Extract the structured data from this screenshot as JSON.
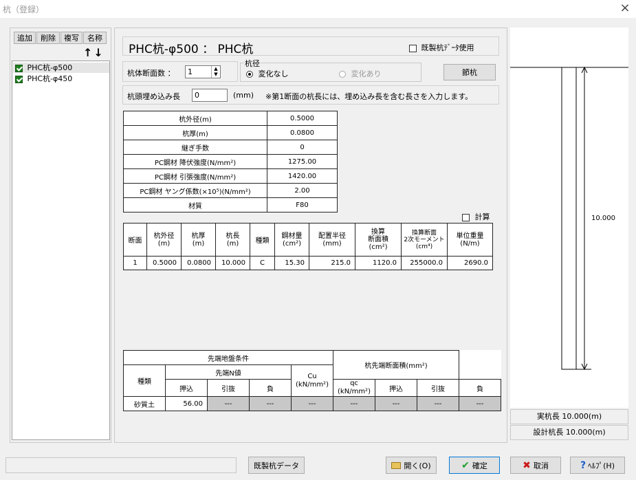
{
  "window": {
    "title": "杭（登録）",
    "close": "×"
  },
  "list": {
    "buttons": [
      "追加",
      "削除",
      "複写",
      "名称"
    ],
    "arrows": "↑↓",
    "items": [
      {
        "label": "PHC杭-φ500",
        "selected": true
      },
      {
        "label": "PHC杭-φ450",
        "selected": false
      }
    ]
  },
  "header": {
    "name": "PHC杭-φ500 ： PHC杭",
    "use_existing": "既製杭ﾃﾞｰﾀ使用"
  },
  "sections": {
    "label": "杭体断面数 ：",
    "value": "1"
  },
  "diameter": {
    "group_label": "杭径",
    "opt1": "変化なし",
    "opt2": "変化あり"
  },
  "node_button": "節杭",
  "embed": {
    "label": "杭頭埋め込み長",
    "value": "0",
    "unit": "(mm)",
    "note": "※第1断面の杭長には、埋め込み長を含む長さを入力します。"
  },
  "props": [
    {
      "name": "杭外径(m)",
      "value": "0.5000"
    },
    {
      "name": "杭厚(m)",
      "value": "0.0800"
    },
    {
      "name": "継ぎ手数",
      "value": "0"
    },
    {
      "name": "PC鋼材 降伏強度(N/mm²)",
      "value": "1275.00"
    },
    {
      "name": "PC鋼材 引張強度(N/mm²)",
      "value": "1420.00"
    },
    {
      "name": "PC鋼材 ヤング係数(×10⁵)(N/mm²)",
      "value": "2.00"
    },
    {
      "name": "材質",
      "value": "F80"
    }
  ],
  "calc_label": "計算",
  "section_table": {
    "headers": [
      "断面",
      "杭外径\n(m)",
      "杭厚\n(m)",
      "杭長\n(m)",
      "種類",
      "鋼材量\n(cm²)",
      "配置半径\n(mm)",
      "換算\n断面積\n(cm²)",
      "換算断面\n2次モーメント\n(cm⁴)",
      "単位重量\n(N/m)"
    ],
    "rows": [
      [
        "1",
        "0.5000",
        "0.0800",
        "10.000",
        "C",
        "15.30",
        "215.0",
        "1120.0",
        "255000.0",
        "2690.0"
      ]
    ]
  },
  "tip_table": {
    "h_ground": "先端地盤条件",
    "h_area": "杭先端断面積(mm²)",
    "h_type": "種類",
    "h_n": "先端N値",
    "h_cu": "Cu\n(kN/mm²)",
    "h_qc": "qc\n(kN/mm²)",
    "h_push": "押込",
    "h_pull": "引抜",
    "h_neg": "負",
    "row": [
      "砂質土",
      "56.00",
      "---",
      "---",
      "---",
      "---",
      "---",
      "---",
      "---"
    ]
  },
  "diagram": {
    "length_label": "10.000"
  },
  "lengths": {
    "actual": "実杭長 10.000(m)",
    "design": "設計杭長 10.000(m)"
  },
  "footer": {
    "existing": "既製杭データ",
    "open": "開く(O)",
    "ok": "確定",
    "cancel": "取消",
    "help": "ﾍﾙﾌﾟ(H)"
  }
}
